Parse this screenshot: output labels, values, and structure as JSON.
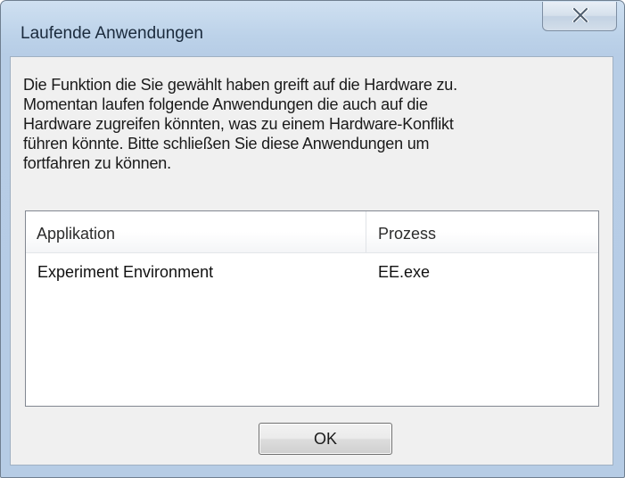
{
  "window": {
    "title": "Laufende Anwendungen",
    "close_icon": "close-x-icon"
  },
  "message": "Die Funktion die Sie gewählt haben greift auf die Hardware zu.\nMomentan laufen folgende Anwendungen die auch auf die\nHardware zugreifen könnten, was zu einem Hardware-Konflikt\nführen könnte. Bitte schließen Sie diese Anwendungen um\nfortfahren zu können.",
  "list": {
    "columns": [
      "Applikation",
      "Prozess"
    ],
    "rows": [
      [
        "Experiment Environment",
        "EE.exe"
      ]
    ]
  },
  "buttons": {
    "ok_label": "OK"
  },
  "colors": {
    "title_bar": "#bcd2e9",
    "client_bg": "#f0f0f0",
    "list_bg": "#ffffff"
  }
}
